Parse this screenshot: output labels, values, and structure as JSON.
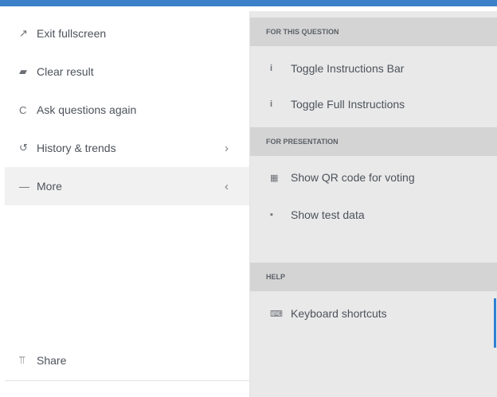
{
  "menu": {
    "items": [
      {
        "label": "Exit fullscreen",
        "icon": "compress-arrows-icon",
        "glyph": "↗"
      },
      {
        "label": "Clear result",
        "icon": "eraser-icon",
        "glyph": "▰"
      },
      {
        "label": "Ask questions again",
        "icon": "refresh-icon",
        "glyph": "C"
      },
      {
        "label": "History & trends",
        "icon": "history-icon",
        "glyph": "↺",
        "chevron": "›"
      },
      {
        "label": "More",
        "icon": "dash-icon",
        "glyph": "—",
        "chevron": "‹"
      }
    ],
    "share_label": "Share",
    "share_glyph": "⫪"
  },
  "submenu": {
    "sections": [
      {
        "header": "FOR THIS QUESTION",
        "items": [
          {
            "label": "Toggle Instructions Bar",
            "icon": "info-icon",
            "glyph": "i"
          },
          {
            "label": "Toggle Full Instructions",
            "icon": "info-icon",
            "glyph": "i"
          }
        ]
      },
      {
        "header": "FOR PRESENTATION",
        "items": [
          {
            "label": "Show QR code for voting",
            "icon": "qr-code-icon",
            "glyph": "▦"
          },
          {
            "label": "Show test data",
            "icon": "lock-icon",
            "glyph": "▪"
          }
        ]
      },
      {
        "header": "HELP",
        "items": [
          {
            "label": "Keyboard shortcuts",
            "icon": "keyboard-icon",
            "glyph": "⌨"
          }
        ]
      }
    ]
  },
  "colors": {
    "accent": "#3b80c9",
    "submenu_bg": "#e9e9e9",
    "section_header_bg": "#d4d4d4",
    "active_item_bg": "#f1f1f1"
  }
}
